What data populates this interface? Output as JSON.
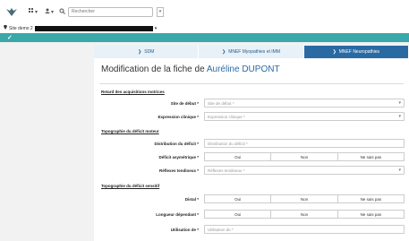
{
  "toolbar": {
    "logo_icon": "leaf-logo-icon",
    "btn1_label": "▾",
    "btn2_label": "▾",
    "search_placeholder": "Rechercher"
  },
  "site": {
    "label": "Site demo 2"
  },
  "tabs": [
    {
      "label": "SDM",
      "active": false
    },
    {
      "label": "MNEF Myopathies et IMM",
      "active": false
    },
    {
      "label": "MNEF Neuropathies",
      "active": true
    }
  ],
  "heading": {
    "prefix": "Modification de la fiche de",
    "name": "Auréline DUPONT"
  },
  "sections": {
    "s1": "Retard des acquisitions motrices",
    "s2": "Topographie du déficit moteur",
    "s3": "Topographie du déficit sensitif"
  },
  "fields": {
    "site_debut": {
      "label": "Site de début *",
      "placeholder": "Site de début *"
    },
    "expression_clinique": {
      "label": "Expression clinique *",
      "placeholder": "Expression clinique *"
    },
    "distribution_deficit": {
      "label": "Distribution du déficit *",
      "placeholder": "Distribution du déficit *"
    },
    "deficit_asymetrique": {
      "label": "Déficit asymétrique *"
    },
    "reflexes_tendineux": {
      "label": "Réflexes tendineux *",
      "placeholder": "Réflexes tendineux *"
    },
    "distal": {
      "label": "Distal *"
    },
    "longueur_dependant": {
      "label": "Longueur dépendant *"
    },
    "utilisation_de": {
      "label": "Utilisation de *",
      "placeholder": "Utilisation de *"
    }
  },
  "choices": {
    "oui": "Oui",
    "non": "Non",
    "nsp": "Ne sais pas"
  },
  "colors": {
    "teal": "#3aa7a8",
    "active_tab": "#2a6aa3",
    "tab_bg": "#e8f1f7"
  }
}
